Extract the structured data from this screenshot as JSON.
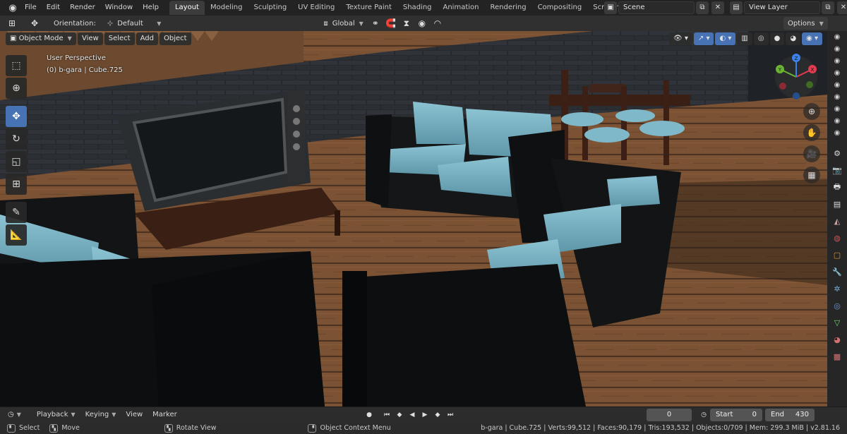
{
  "menu": {
    "logo_icon": "blender-logo",
    "items": [
      "File",
      "Edit",
      "Render",
      "Window",
      "Help"
    ]
  },
  "workspaces": {
    "tabs": [
      "Layout",
      "Modeling",
      "Sculpting",
      "UV Editing",
      "Texture Paint",
      "Shading",
      "Animation",
      "Rendering",
      "Compositing",
      "Scripting"
    ],
    "active": "Layout"
  },
  "scene": {
    "name": "Scene",
    "view_layer": "View Layer"
  },
  "header": {
    "orientation_label": "Orientation:",
    "orientation_value": "Default",
    "transform_orientation": "Global",
    "options_label": "Options"
  },
  "viewport": {
    "mode": "Object Mode",
    "menus": [
      "View",
      "Select",
      "Add",
      "Object"
    ],
    "perspective_text": "User Perspective",
    "object_text": "(0) b-gara | Cube.725",
    "gizmo_axes": {
      "x": "X",
      "y": "Y",
      "z": "Z"
    },
    "colors": {
      "x": "#e23b50",
      "y": "#6ab532",
      "z": "#3d82e8",
      "active": "#4772b3"
    }
  },
  "timeline": {
    "playback": "Playback",
    "keying": "Keying",
    "view": "View",
    "marker": "Marker",
    "current_frame": "0",
    "start_label": "Start",
    "start_value": "0",
    "end_label": "End",
    "end_value": "430"
  },
  "statusbar": {
    "select": "Select",
    "move": "Move",
    "rotate": "Rotate View",
    "context_menu": "Object Context Menu",
    "stats": "b-gara | Cube.725 | Verts:99,512 | Faces:90,179 | Tris:193,532 | Objects:0/709 | Mem: 299.3 MiB | v2.81.16"
  }
}
